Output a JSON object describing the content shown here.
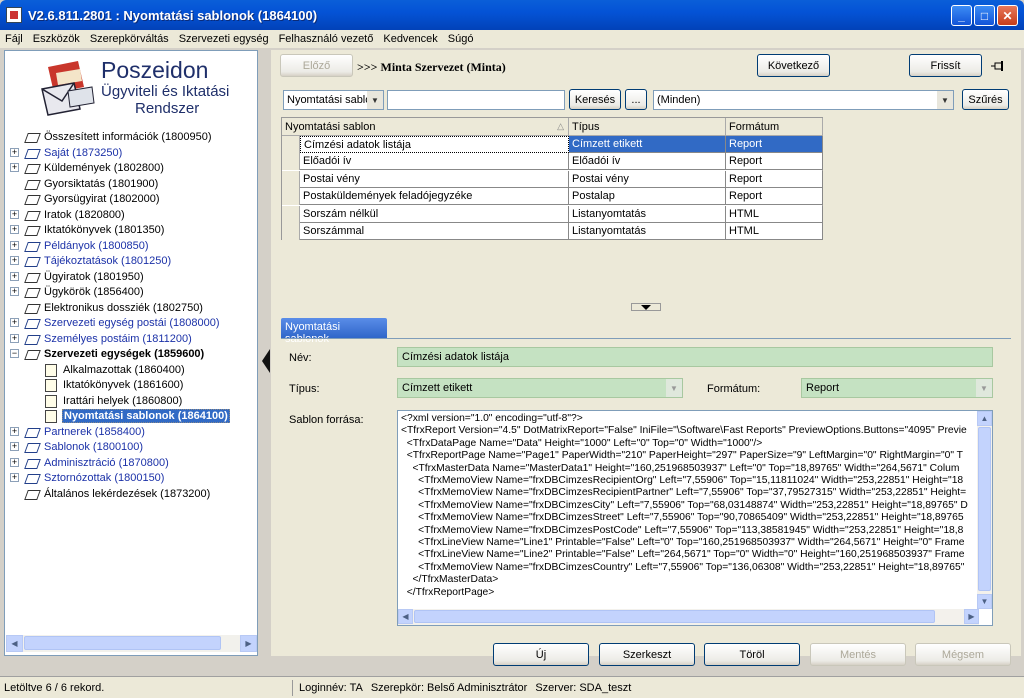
{
  "window": {
    "title": "V2.6.811.2801 : Nyomtatási sablonok (1864100)"
  },
  "menu": [
    "Fájl",
    "Eszközök",
    "Szerepkörváltás",
    "Szervezeti egység",
    "Felhasználó vezető",
    "Kedvencek",
    "Súgó"
  ],
  "logo": {
    "line1": "Poszeidon",
    "line2": "Ügyviteli és Iktatási",
    "line3": "Rendszer"
  },
  "tree": [
    {
      "label": "Összesített információk (1800950)",
      "style": "normal",
      "expand": false
    },
    {
      "label": "Saját (1873250)",
      "style": "blue",
      "expand": true
    },
    {
      "label": "Küldemények (1802800)",
      "style": "normal",
      "expand": true
    },
    {
      "label": "Gyorsiktatás (1801900)",
      "style": "normal",
      "expand": false
    },
    {
      "label": "Gyorsügyirat (1802000)",
      "style": "normal",
      "expand": false
    },
    {
      "label": "Iratok (1820800)",
      "style": "normal",
      "expand": true
    },
    {
      "label": "Iktatókönyvek (1801350)",
      "style": "normal",
      "expand": true
    },
    {
      "label": "Példányok (1800850)",
      "style": "blue",
      "expand": true
    },
    {
      "label": "Tájékoztatások (1801250)",
      "style": "blue",
      "expand": true
    },
    {
      "label": "Ügyiratok (1801950)",
      "style": "normal",
      "expand": true
    },
    {
      "label": "Ügykörök (1856400)",
      "style": "normal",
      "expand": true
    },
    {
      "label": "Elektronikus dossziék (1802750)",
      "style": "normal",
      "expand": false
    },
    {
      "label": "Szervezeti egység postái (1808000)",
      "style": "blue",
      "expand": true
    },
    {
      "label": "Személyes postáim (1811200)",
      "style": "blue",
      "expand": true
    },
    {
      "label": "Szervezeti egységek (1859600)",
      "style": "bold",
      "expand": "minus"
    },
    {
      "label": "Alkalmazottak (1860400)",
      "style": "child",
      "expand": false
    },
    {
      "label": "Iktatókönyvek (1861600)",
      "style": "child",
      "expand": false
    },
    {
      "label": "Irattári helyek (1860800)",
      "style": "child",
      "expand": false
    },
    {
      "label": "Nyomtatási sablonok (1864100)",
      "style": "selected",
      "expand": false
    },
    {
      "label": "Partnerek (1858400)",
      "style": "blue",
      "expand": true
    },
    {
      "label": "Sablonok (1800100)",
      "style": "blue",
      "expand": true
    },
    {
      "label": "Adminisztráció (1870800)",
      "style": "blue",
      "expand": true
    },
    {
      "label": "Sztornózottak (1800150)",
      "style": "blue",
      "expand": true
    },
    {
      "label": "Általános lekérdezések (1873200)",
      "style": "normal",
      "expand": false
    }
  ],
  "nav": {
    "prev_label": "Előző",
    "breadcrumb": ">>> Minta Szervezet (Minta)",
    "next_label": "Következő",
    "refresh_label": "Frissít"
  },
  "filter": {
    "field_select": "Nyomtatási sablon",
    "search_value": "",
    "search_label": "Keresés",
    "ellipsis_label": "...",
    "scope_select": "(Minden)",
    "filter_label": "Szűrés"
  },
  "grid": {
    "columns": [
      "Nyomtatási sablon",
      "Típus",
      "Formátum"
    ],
    "rows": [
      [
        "Címzési adatok listája",
        "Címzett etikett",
        "Report"
      ],
      [
        "Előadói ív",
        "Előadói ív",
        "Report"
      ],
      [
        "Postai vény",
        "Postai vény",
        "Report"
      ],
      [
        "Postaküldemények feladójegyzéke",
        "Postalap",
        "Report"
      ],
      [
        "Sorszám nélkül",
        "Listanyomtatás",
        "HTML"
      ],
      [
        "Sorszámmal",
        "Listanyomtatás",
        "HTML"
      ]
    ]
  },
  "detail": {
    "tab_label": "Nyomtatási sablonok",
    "name_label": "Név:",
    "name_value": "Címzési adatok listája",
    "type_label": "Típus:",
    "type_value": "Címzett etikett",
    "format_label": "Formátum:",
    "format_value": "Report",
    "source_label": "Sablon forrása:",
    "source_text": "<?xml version=\"1.0\" encoding=\"utf-8\"?>\n<TfrxReport Version=\"4.5\" DotMatrixReport=\"False\" IniFile=\"\\Software\\Fast Reports\" PreviewOptions.Buttons=\"4095\" Previe\n  <TfrxDataPage Name=\"Data\" Height=\"1000\" Left=\"0\" Top=\"0\" Width=\"1000\"/>\n  <TfrxReportPage Name=\"Page1\" PaperWidth=\"210\" PaperHeight=\"297\" PaperSize=\"9\" LeftMargin=\"0\" RightMargin=\"0\" T\n    <TfrxMasterData Name=\"MasterData1\" Height=\"160,251968503937\" Left=\"0\" Top=\"18,89765\" Width=\"264,5671\" Colum\n      <TfrxMemoView Name=\"frxDBCimzesRecipientOrg\" Left=\"7,55906\" Top=\"15,11811024\" Width=\"253,22851\" Height=\"18\n      <TfrxMemoView Name=\"frxDBCimzesRecipientPartner\" Left=\"7,55906\" Top=\"37,79527315\" Width=\"253,22851\" Height=\n      <TfrxMemoView Name=\"frxDBCimzesCity\" Left=\"7,55906\" Top=\"68,03148874\" Width=\"253,22851\" Height=\"18,89765\" D\n      <TfrxMemoView Name=\"frxDBCimzesStreet\" Left=\"7,55906\" Top=\"90,70865409\" Width=\"253,22851\" Height=\"18,89765\n      <TfrxMemoView Name=\"frxDBCimzesPostCode\" Left=\"7,55906\" Top=\"113,38581945\" Width=\"253,22851\" Height=\"18,8\n      <TfrxLineView Name=\"Line1\" Printable=\"False\" Left=\"0\" Top=\"160,251968503937\" Width=\"264,5671\" Height=\"0\" Frame\n      <TfrxLineView Name=\"Line2\" Printable=\"False\" Left=\"264,5671\" Top=\"0\" Width=\"0\" Height=\"160,251968503937\" Frame\n      <TfrxMemoView Name=\"frxDBCimzesCountry\" Left=\"7,55906\" Top=\"136,06308\" Width=\"253,22851\" Height=\"18,89765\" \n    </TfrxMasterData>\n  </TfrxReportPage>"
  },
  "actions": {
    "new": "Új",
    "edit": "Szerkeszt",
    "delete": "Töröl",
    "save": "Mentés",
    "cancel": "Mégsem"
  },
  "status": {
    "loaded": "Letöltve 6 / 6 rekord.",
    "login": "Loginnév: TA",
    "role": "Szerepkör: Belső Adminisztrátor",
    "server": "Szerver: SDA_teszt"
  }
}
